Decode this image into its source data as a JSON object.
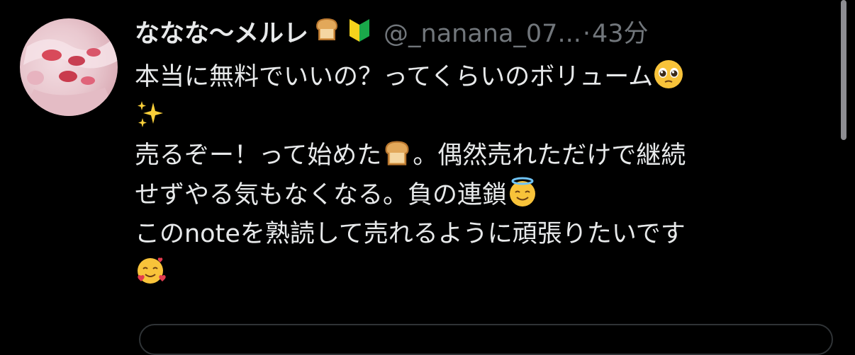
{
  "tweet": {
    "display_name": "ななな〜メルレ",
    "name_emojis": [
      "bread-icon",
      "beginner-mark-icon"
    ],
    "handle": "@_nanana_07...",
    "separator": "·",
    "time": "43分",
    "lines": [
      {
        "text": "本当に無料でいいの？ってくらいのボリューム",
        "emoji": "pleading-face-icon"
      },
      {
        "text": "",
        "emoji": "sparkles-icon"
      },
      {
        "text": "売るぞー！って始めた",
        "emoji": "bread-icon",
        "after": "。偶然売れただけで継続"
      },
      {
        "text": "せずやる気もなくなる。負の連鎖",
        "emoji": "halo-face-icon"
      },
      {
        "text": "このnoteを熟読して売れるように頑張りたいです",
        "emoji": ""
      },
      {
        "text": "",
        "emoji": "smiling-face-with-hearts-icon"
      }
    ]
  },
  "colors": {
    "background": "#000000",
    "text_primary": "#e7e9ea",
    "text_secondary": "#71767b",
    "scrollbar": "#8d8d92"
  }
}
